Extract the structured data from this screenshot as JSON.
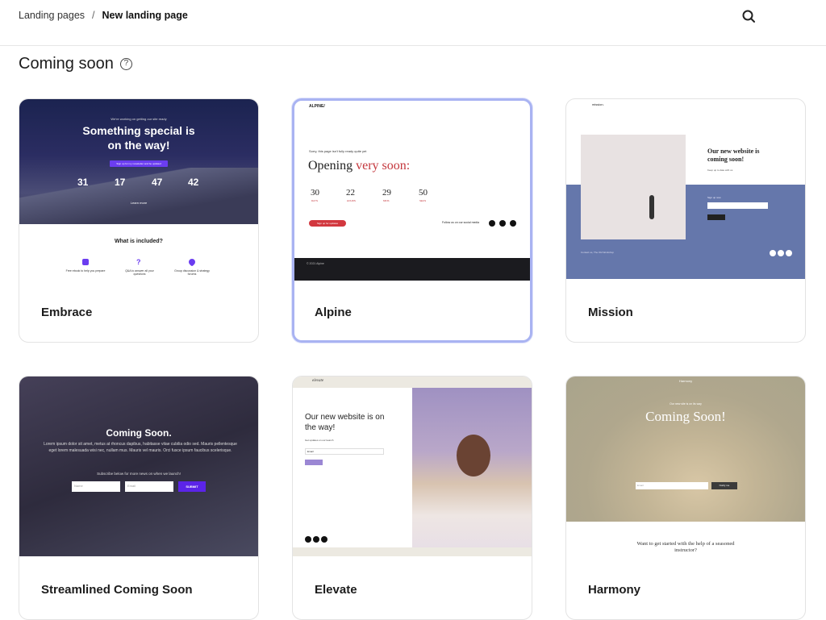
{
  "breadcrumb": {
    "root": "Landing pages",
    "separator": "/",
    "current": "New landing page"
  },
  "section": {
    "title": "Coming soon",
    "help_icon": "question-circle-icon"
  },
  "accent_selected": "#a9b3f2",
  "templates": [
    {
      "name": "Embrace",
      "preview": {
        "kicker": "We're working on getting our site ready",
        "headline": "Something special is on the way!",
        "button": "Sign up for my newsletter and be updated",
        "countdown": [
          "31",
          "17",
          "47",
          "42"
        ],
        "learn_more": "Learn more",
        "included_title": "What is included?",
        "features": [
          "Free ebook to help you prepare",
          "Q&A to answer all your questions",
          "Group discussion & strategy forums"
        ]
      }
    },
    {
      "name": "Alpine",
      "selected": true,
      "preview": {
        "logo": "ALPINE/",
        "kicker": "Sorry, this page isn't fully ready quite yet",
        "headline_plain": "Opening",
        "headline_accent": "very soon:",
        "countdown": [
          "30",
          "22",
          "29",
          "50"
        ],
        "countdown_labels": [
          "DAYS",
          "HOURS",
          "MINS",
          "SECS"
        ],
        "button": "Sign up for updates",
        "follow": "Follow us on our social media",
        "footer": "© 2021 Alpine"
      }
    },
    {
      "name": "Mission",
      "preview": {
        "logo": "mission.",
        "headline": "Our new website is coming soon!",
        "sub": "Keep up to date with us",
        "signup": "Sign up now",
        "footer": "Contact us, The Old Workshop"
      }
    },
    {
      "name": "Streamlined Coming Soon",
      "preview": {
        "headline": "Coming Soon.",
        "body": "Lorem ipsum dolor sit amet, metus at rhoncus dapibus, habitasse vitae cubilia odio sed. Mauris pellentesque eget lorem malesuada wisi nec, nullam mus. Mauris vel mauris. Orci fusce ipsum faucibus scelerisque.",
        "subscribe": "Subscribe below for more news on when we launch!",
        "name_placeholder": "Name",
        "email_placeholder": "Email",
        "button": "SUBMIT"
      }
    },
    {
      "name": "Elevate",
      "preview": {
        "logo": "elevate",
        "headline": "Our new website is on the way!",
        "sub": "Get updates on our launch",
        "email_placeholder": "Email"
      }
    },
    {
      "name": "Harmony",
      "preview": {
        "logo": "Harmony",
        "kicker": "Our new site is on its way",
        "headline": "Coming Soon!",
        "email_placeholder": "Email",
        "button": "Notify me",
        "question": "Want to get started with the help of a seasoned instructor?"
      }
    }
  ]
}
